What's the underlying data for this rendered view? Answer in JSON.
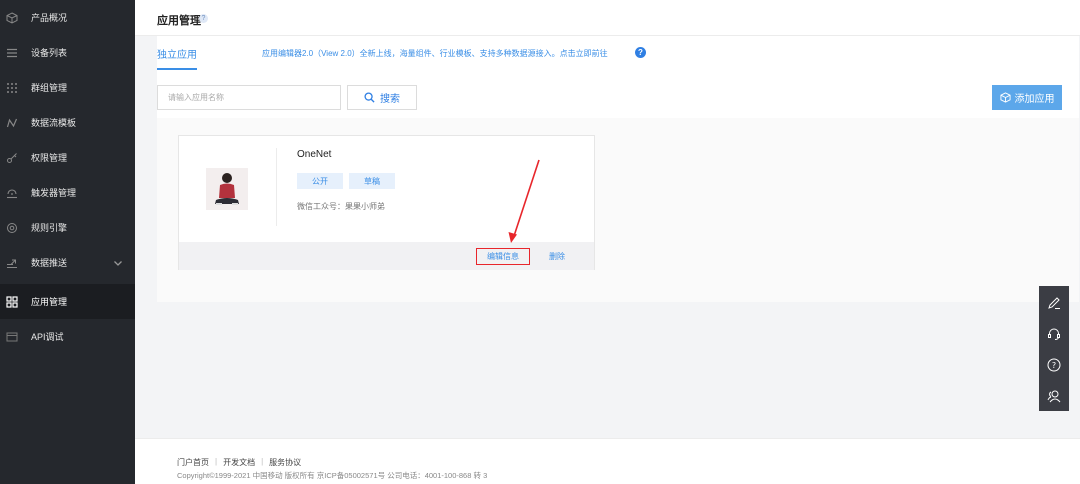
{
  "sidebar": {
    "items": [
      {
        "label": "产品概况",
        "icon": "cube-icon"
      },
      {
        "label": "设备列表",
        "icon": "list-icon"
      },
      {
        "label": "群组管理",
        "icon": "grid-dots-icon"
      },
      {
        "label": "数据流模板",
        "icon": "stream-icon"
      },
      {
        "label": "权限管理",
        "icon": "key-icon"
      },
      {
        "label": "触发器管理",
        "icon": "trigger-icon"
      },
      {
        "label": "规则引擎",
        "icon": "engine-icon"
      },
      {
        "label": "数据推送",
        "icon": "push-icon"
      },
      {
        "label": "应用管理",
        "icon": "apps-icon"
      },
      {
        "label": "API调试",
        "icon": "api-icon"
      }
    ],
    "active_index": 8
  },
  "header": {
    "title": "应用管理",
    "help": "?"
  },
  "tabs": [
    {
      "label": "独立应用"
    }
  ],
  "announcement": "应用编辑器2.0（View 2.0）全新上线，海量组件、行业模板、支持多种数据源接入。点击立即前往",
  "announcement_help": "?",
  "search": {
    "placeholder": "请输入应用名称",
    "button_label": "搜索"
  },
  "add_button_label": "添加应用",
  "app_card": {
    "name": "OneNet",
    "tags": [
      "公开",
      "草稿"
    ],
    "wechat": "微信工众号：果果小师弟",
    "edit_label": "编辑信息",
    "delete_label": "删除"
  },
  "float_tools": [
    "edit-icon",
    "headset-icon",
    "help-circle-icon",
    "users-icon"
  ],
  "footer": {
    "links": [
      "门户首页",
      "开发文档",
      "服务协议"
    ],
    "copyright": "Copyright©1999-2021 中国移动 版权所有 京ICP备05002571号 公司电话：4001-100-868 转 3"
  },
  "colors": {
    "accent": "#3a8ee6",
    "sidebar_bg": "#25282d",
    "annotation": "#e8262b"
  }
}
